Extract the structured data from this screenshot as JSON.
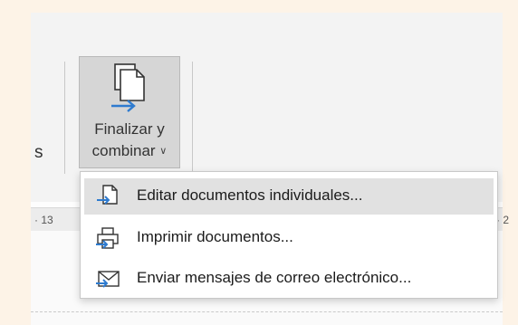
{
  "ribbon": {
    "left_partial_label": "s",
    "finish_button": {
      "line1": "Finalizar y",
      "line2": "combinar",
      "icon": "finish-merge-icon"
    }
  },
  "ruler": {
    "left_number": "· 13",
    "right_partial": "· 2"
  },
  "menu": {
    "items": [
      {
        "label": "Editar documentos individuales...",
        "icon": "edit-documents-icon",
        "highlighted": true
      },
      {
        "label": "Imprimir documentos...",
        "icon": "printer-icon",
        "highlighted": false
      },
      {
        "label": "Enviar mensajes de correo electrónico...",
        "icon": "email-icon",
        "highlighted": false
      }
    ]
  },
  "colors": {
    "accent_blue": "#2e7bcf",
    "highlight": "#e1e1e1",
    "pressed_button": "#d6d6d6"
  }
}
